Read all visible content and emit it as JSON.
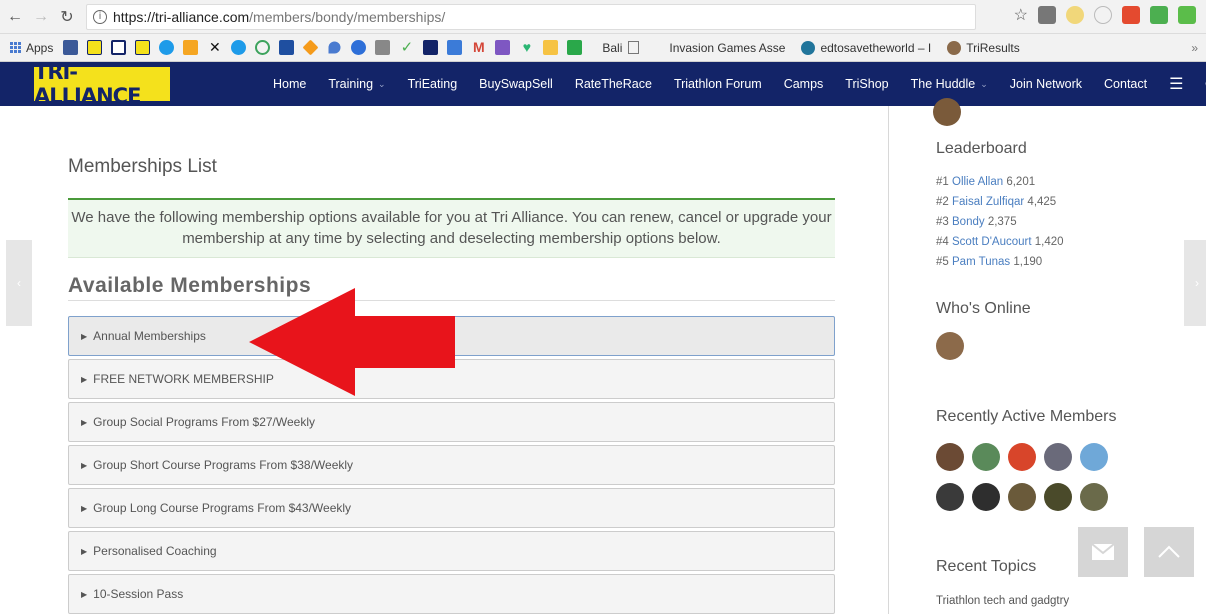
{
  "browser": {
    "url_host": "https://tri-alliance.com",
    "url_path": "/members/bondy/memberships/",
    "bookmarks": {
      "apps_label": "Apps",
      "bali_label": "Bali",
      "invasion_label": "Invasion Games Asse",
      "edtosave_label": "edtosavetheworld – I",
      "triresults_label": "TriResults",
      "more": "»"
    }
  },
  "site": {
    "logo": "TRI-ALLIANCE",
    "menu": [
      "Home",
      "Training",
      "TriEating",
      "BuySwapSell",
      "RateTheRace",
      "Triathlon Forum",
      "Camps",
      "TriShop",
      "The Huddle",
      "Join Network",
      "Contact"
    ]
  },
  "main": {
    "title": "Memberships List",
    "notice": "We have the following membership options available for you at Tri Alliance. You can renew, cancel or upgrade your membership at any time by selecting and deselecting membership options below.",
    "section_title": "Available Memberships",
    "memberships": [
      "Annual Memberships",
      "FREE NETWORK MEMBERSHIP",
      "Group Social Programs From $27/Weekly",
      "Group Short Course Programs From $38/Weekly",
      "Group Long Course Programs From $43/Weekly",
      "Personalised Coaching",
      "10-Session Pass"
    ]
  },
  "sidebar": {
    "leaderboard_title": "Leaderboard",
    "leaderboard": [
      {
        "rank": "#1",
        "name": "Ollie Allan",
        "score": "6,201"
      },
      {
        "rank": "#2",
        "name": "Faisal Zulfiqar",
        "score": "4,425"
      },
      {
        "rank": "#3",
        "name": "Bondy",
        "score": "2,375"
      },
      {
        "rank": "#4",
        "name": "Scott D'Aucourt",
        "score": "1,420"
      },
      {
        "rank": "#5",
        "name": "Pam Tunas",
        "score": "1,190"
      }
    ],
    "online_title": "Who's Online",
    "active_title": "Recently Active Members",
    "topics_title": "Recent Topics",
    "topic_1": "Triathlon tech and gadgtry"
  },
  "colors": {
    "nav_bg": "#132468",
    "logo_bg": "#f4e11c",
    "arrow": "#e8141b",
    "notice_border": "#4a9a3a",
    "link": "#4a7ec0"
  }
}
